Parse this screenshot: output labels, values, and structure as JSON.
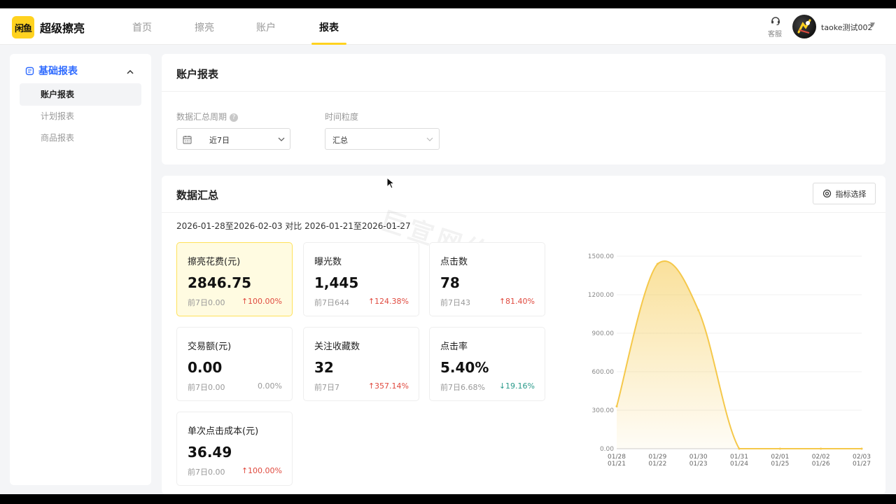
{
  "brand": {
    "logo_text": "闲鱼",
    "name": "超级擦亮"
  },
  "nav": {
    "tabs": [
      {
        "label": "首页"
      },
      {
        "label": "擦亮"
      },
      {
        "label": "账户"
      },
      {
        "label": "报表"
      }
    ]
  },
  "header": {
    "service_label": "客服",
    "user_name": "taoke测试002"
  },
  "sidebar": {
    "group_label": "基础报表",
    "items": [
      {
        "label": "账户报表"
      },
      {
        "label": "计划报表"
      },
      {
        "label": "商品报表"
      }
    ]
  },
  "report": {
    "title": "账户报表",
    "period_label": "数据汇总周期",
    "period_value": "近7日",
    "granularity_label": "时间粒度",
    "granularity_value": "汇总"
  },
  "summary": {
    "title": "数据汇总",
    "metric_button": "指标选择",
    "range_text": "2026-01-28至2026-02-03 对比 2026-01-21至2026-01-27",
    "watermark": "巨宣网络",
    "kpis": [
      {
        "label": "擦亮花费(元)",
        "value": "2846.75",
        "prev": "前7日0.00",
        "change": "↑100.00%"
      },
      {
        "label": "曝光数",
        "value": "1,445",
        "prev": "前7日644",
        "change": "↑124.38%"
      },
      {
        "label": "点击数",
        "value": "78",
        "prev": "前7日43",
        "change": "↑81.40%"
      },
      {
        "label": "交易额(元)",
        "value": "0.00",
        "prev": "前7日0.00",
        "change": "0.00%"
      },
      {
        "label": "关注收藏数",
        "value": "32",
        "prev": "前7日7",
        "change": "↑357.14%"
      },
      {
        "label": "点击率",
        "value": "5.40%",
        "prev": "前7日6.68%",
        "change": "↓19.16%"
      },
      {
        "label": "单次点击成本(元)",
        "value": "36.49",
        "prev": "前7日0.00",
        "change": "↑100.00%"
      }
    ]
  },
  "colors": {
    "accent": "#ffd21f",
    "link": "#2f6bff",
    "up": "#e04a3f",
    "down": "#2a9a8a"
  },
  "chart_data": {
    "type": "area",
    "x": [
      "01/28",
      "01/29",
      "01/30",
      "01/31",
      "02/01",
      "02/02",
      "02/03"
    ],
    "x_compare": [
      "01/21",
      "01/22",
      "01/23",
      "01/24",
      "01/25",
      "01/26",
      "01/27"
    ],
    "series": [
      {
        "values": [
          330,
          1440,
          1080,
          0,
          0,
          0,
          0
        ]
      }
    ],
    "yticks": [
      "0.00",
      "300.00",
      "600.00",
      "900.00",
      "1200.00",
      "1500.00"
    ],
    "ylim": [
      0,
      1500
    ],
    "grid": true,
    "color": "#f5c84a"
  }
}
